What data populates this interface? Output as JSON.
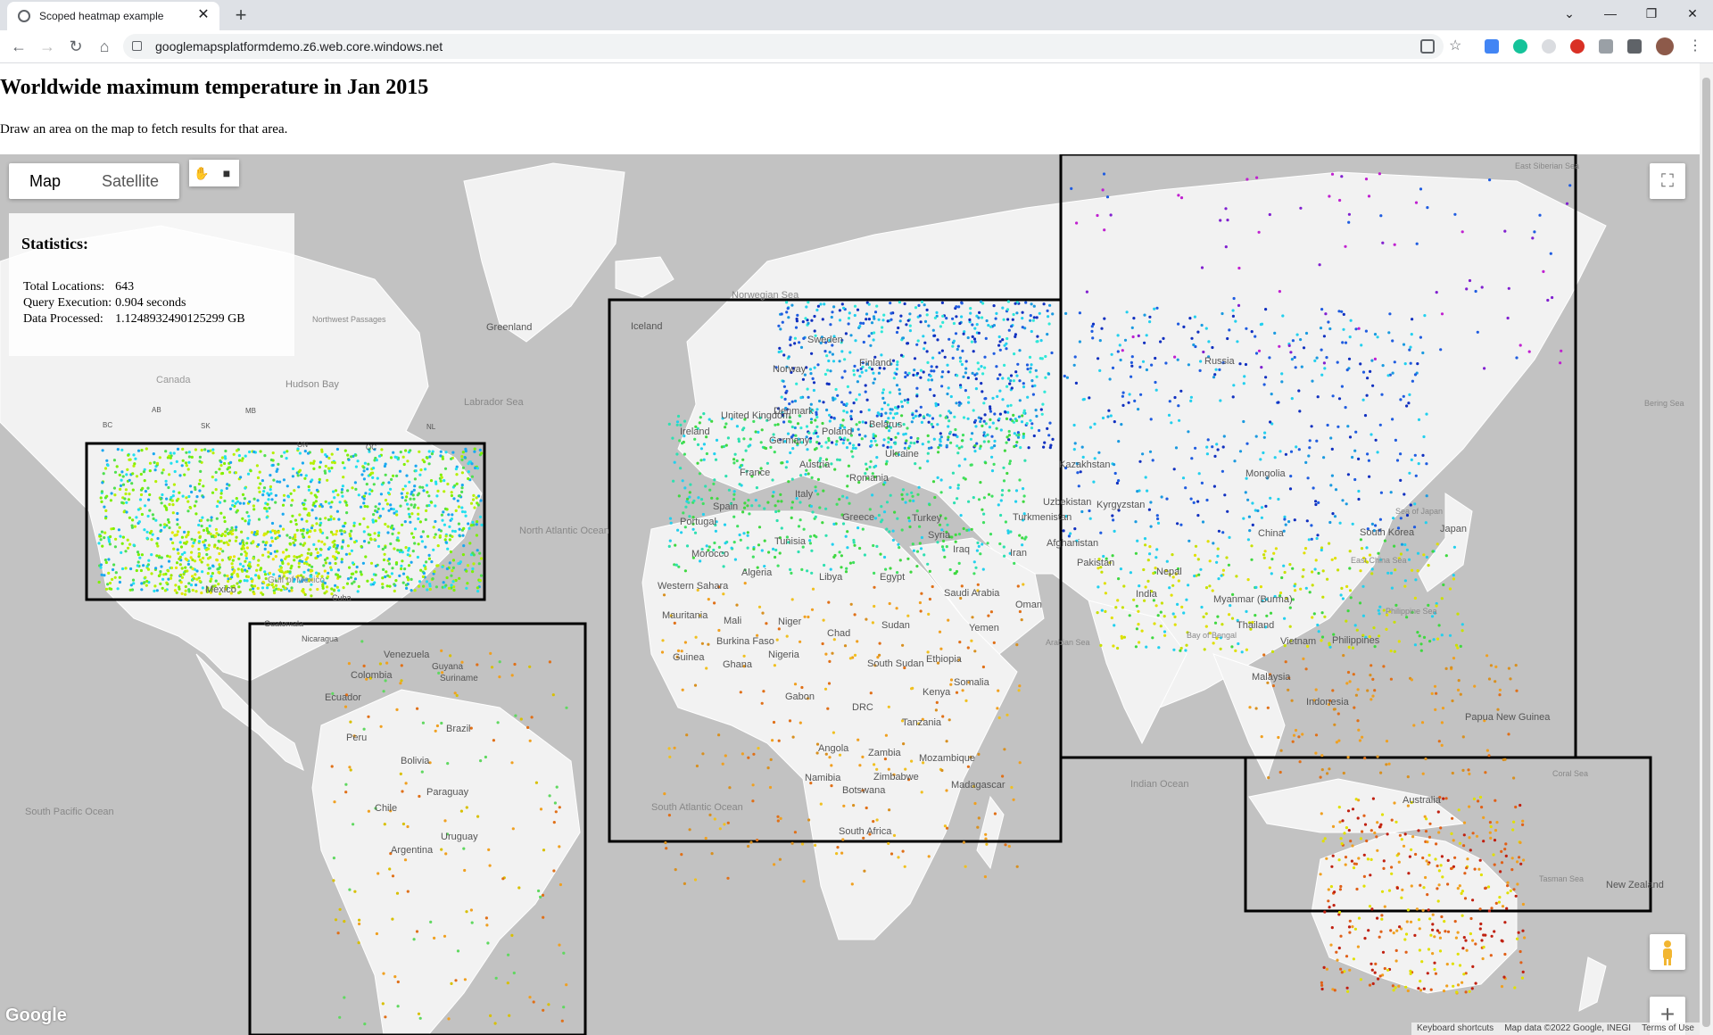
{
  "browser": {
    "tab_title": "Scoped heatmap example",
    "tab_close": "✕",
    "new_tab": "+",
    "url": "googlemapsplatformdemo.z6.web.core.windows.net",
    "window_buttons": [
      "⌄",
      "—",
      "❐",
      "✕"
    ],
    "nav": {
      "back": "←",
      "forward": "→",
      "reload": "↻",
      "home": "⌂"
    }
  },
  "page": {
    "title": "Worldwide maximum temperature in Jan 2015",
    "subtitle": "Draw an area on the map to fetch results for that area."
  },
  "map": {
    "type_buttons": [
      "Map",
      "Satellite"
    ],
    "draw_tools": {
      "hand": "✋",
      "rectangle": "■"
    },
    "fullscreen": "⛶",
    "zoom_in": "+",
    "zoom_out": "−",
    "logo": "Google",
    "attribution": [
      "Keyboard shortcuts",
      "Map data ©2022 Google, INEGI",
      "Terms of Use"
    ],
    "labels": {
      "greenland": "Greenland",
      "iceland": "Iceland",
      "norwegian_sea": "Norwegian Sea",
      "labrador_sea": "Labrador Sea",
      "northwest_passages": "Northwest Passages",
      "hudson_bay": "Hudson Bay",
      "canada": "Canada",
      "ab": "AB",
      "mb": "MB",
      "bc": "BC",
      "sk": "SK",
      "on": "ON",
      "qc": "QC",
      "nl": "NL",
      "north_atlantic": "North Atlantic Ocean",
      "mexico": "Mexico",
      "gulf_mexico": "Gulf of Mexico",
      "cuba": "Cuba",
      "guatemala": "Guatemala",
      "nicaragua": "Nicaragua",
      "venezuela": "Venezuela",
      "guyana": "Guyana",
      "suriname": "Suriname",
      "colombia": "Colombia",
      "ecuador": "Ecuador",
      "peru": "Peru",
      "brazil": "Brazil",
      "bolivia": "Bolivia",
      "paraguay": "Paraguay",
      "chile": "Chile",
      "argentina": "Argentina",
      "uruguay": "Uruguay",
      "south_pacific": "South Pacific Ocean",
      "south_atlantic": "South Atlantic Ocean",
      "sweden": "Sweden",
      "norway": "Norway",
      "finland": "Finland",
      "united_kingdom": "United Kingdom",
      "ireland": "Ireland",
      "denmark": "Denmark",
      "poland": "Poland",
      "belarus": "Belarus",
      "germany": "Germany",
      "ukraine": "Ukraine",
      "france": "France",
      "austria": "Austria",
      "romania": "Romania",
      "italy": "Italy",
      "spain": "Spain",
      "portugal": "Portugal",
      "greece": "Greece",
      "turkey": "Turkey",
      "syria": "Syria",
      "iraq": "Iraq",
      "iran": "Iran",
      "morocco": "Morocco",
      "tunisia": "Tunisia",
      "algeria": "Algeria",
      "libya": "Libya",
      "egypt": "Egypt",
      "western_sahara": "Western Sahara",
      "mauritania": "Mauritania",
      "mali": "Mali",
      "niger": "Niger",
      "chad": "Chad",
      "sudan": "Sudan",
      "burkina_faso": "Burkina Faso",
      "guinea": "Guinea",
      "ghana": "Ghana",
      "nigeria": "Nigeria",
      "ethiopia": "Ethiopia",
      "south_sudan": "South Sudan",
      "somalia": "Somalia",
      "kenya": "Kenya",
      "gabon": "Gabon",
      "drc": "DRC",
      "tanzania": "Tanzania",
      "angola": "Angola",
      "zambia": "Zambia",
      "mozambique": "Mozambique",
      "namibia": "Namibia",
      "zimbabwe": "Zimbabwe",
      "botswana": "Botswana",
      "madagascar": "Madagascar",
      "south_africa": "South Africa",
      "saudi_arabia": "Saudi Arabia",
      "yemen": "Yemen",
      "oman": "Oman",
      "russia": "Russia",
      "kazakhstan": "Kazakhstan",
      "uzbekistan": "Uzbekistan",
      "kyrgyzstan": "Kyrgyzstan",
      "turkmenistan": "Turkmenistan",
      "afghanistan": "Afghanistan",
      "pakistan": "Pakistan",
      "mongolia": "Mongolia",
      "china": "China",
      "nepal": "Nepal",
      "india": "India",
      "myanmar": "Myanmar (Burma)",
      "thailand": "Thailand",
      "vietnam": "Vietnam",
      "philippines": "Philippines",
      "malaysia": "Malaysia",
      "indonesia": "Indonesia",
      "south_korea": "South Korea",
      "japan": "Japan",
      "papua_new_guinea": "Papua New Guinea",
      "australia": "Australia",
      "new_zealand": "New Zealand",
      "indian_ocean": "Indian Ocean",
      "sea_of_japan": "Sea of Japan",
      "east_china_sea": "East China Sea",
      "philippine_sea": "Philippine Sea",
      "coral_sea": "Coral Sea",
      "tasman_sea": "Tasman Sea",
      "bering_sea": "Bering Sea",
      "east_siberian_sea": "East Siberian Sea",
      "bay_of_bengal": "Bay of Bengal",
      "arabian_sea": "Arabian Sea"
    }
  },
  "statistics": {
    "heading": "Statistics:",
    "rows": [
      {
        "label": "Total Locations:",
        "value": "643"
      },
      {
        "label": "Query Execution:",
        "value": "0.904 seconds"
      },
      {
        "label": "Data Processed:",
        "value": "1.1248932490125299 GB"
      }
    ]
  },
  "colors": {
    "land": "#f2f2f2",
    "water": "#c2c2c2",
    "cold": "#1f2fd0",
    "mid": "#2ee0ee",
    "warm": "#3bd93b",
    "hot": "#ee8a22"
  }
}
